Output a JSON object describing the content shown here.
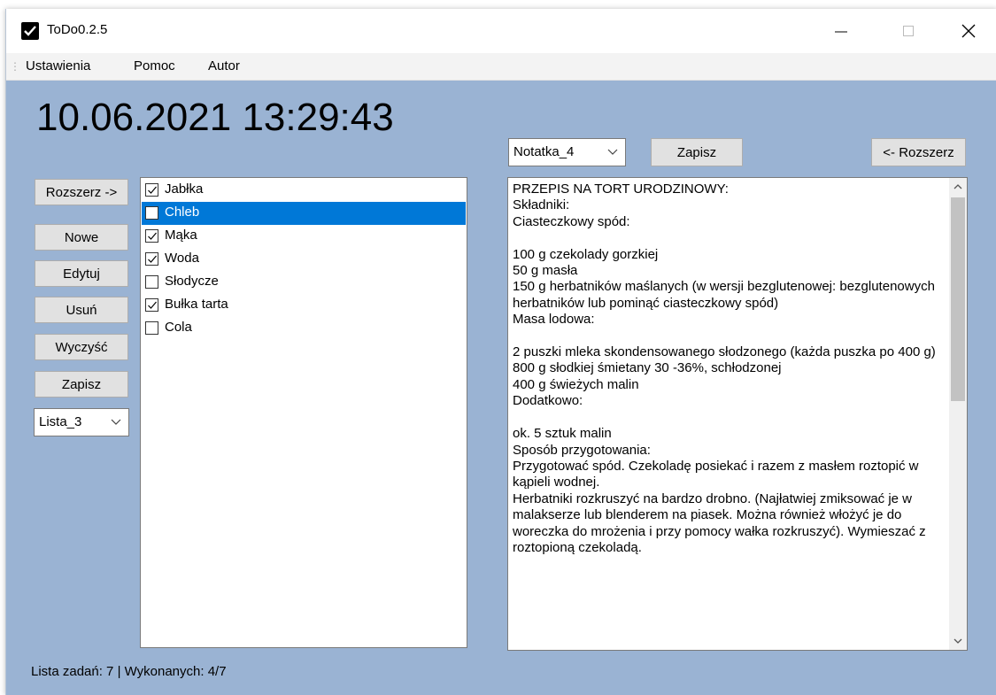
{
  "window": {
    "title": "ToDo0.2.5"
  },
  "menu": [
    "Ustawienia",
    "Pomoc",
    "Autor"
  ],
  "clock": "10.06.2021 13:29:43",
  "left_buttons": {
    "expand": "Rozszerz ->",
    "new": "Nowe",
    "edit": "Edytuj",
    "delete": "Usuń",
    "clear": "Wyczyść",
    "save": "Zapisz"
  },
  "list_select": {
    "value": "Lista_3"
  },
  "tasks": [
    {
      "label": "Jabłka",
      "checked": true,
      "selected": false
    },
    {
      "label": "Chleb",
      "checked": false,
      "selected": true
    },
    {
      "label": "Mąka",
      "checked": true,
      "selected": false
    },
    {
      "label": "Woda",
      "checked": true,
      "selected": false
    },
    {
      "label": "Słodycze",
      "checked": false,
      "selected": false
    },
    {
      "label": "Bułka tarta",
      "checked": true,
      "selected": false
    },
    {
      "label": "Cola",
      "checked": false,
      "selected": false
    }
  ],
  "note_select": {
    "value": "Notatka_4"
  },
  "note_buttons": {
    "save": "Zapisz",
    "collapse": "<- Rozszerz"
  },
  "note_text": "PRZEPIS NA TORT URODZINOWY:\nSkładniki:\nCiasteczkowy spód:\n\n100 g czekolady gorzkiej\n50 g masła\n150 g herbatników maślanych (w wersji bezglutenowej: bezglutenowych herbatników lub pominąć ciasteczkowy spód)\nMasa lodowa:\n\n2 puszki mleka skondensowanego słodzonego (każda puszka po 400 g)\n800 g słodkiej śmietany 30 -36%, schłodzonej\n400 g świeżych malin\nDodatkowo:\n\nok. 5 sztuk malin\nSposób przygotowania:\nPrzygotować spód. Czekoladę posiekać i razem z masłem roztopić w kąpieli wodnej.\nHerbatniki rozkruszyć na bardzo drobno. (Najłatwiej zmiksować je w malakserze lub blenderem na piasek. Można również włożyć je do woreczka do mrożenia i przy pomocy wałka rozkruszyć). Wymieszać z roztopioną czekoladą.",
  "status": "Lista zadań: 7 | Wykonanych: 4/7"
}
